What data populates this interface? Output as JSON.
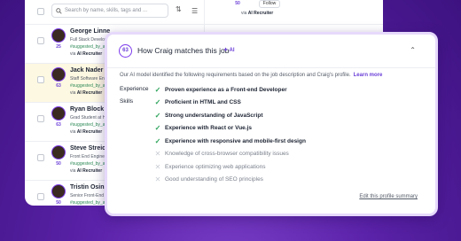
{
  "search": {
    "placeholder": "Search by name, skills, tags and ..."
  },
  "candidates": [
    {
      "name": "George Linne",
      "role": "Full Stack Develop",
      "tag": "#suggested_by_a",
      "via_prefix": "via",
      "via": "AI Recruiter",
      "score": "25",
      "highlight": false
    },
    {
      "name": "Jack Nader",
      "role": "Staff Software Eng",
      "tag": "#suggested_by_a",
      "via_prefix": "via",
      "via": "AI Recruiter",
      "score": "63",
      "highlight": true
    },
    {
      "name": "Ryan Block",
      "role": "Grad Student at H",
      "tag": "#suggested_by_a",
      "via_prefix": "via",
      "via": "AI Recruiter",
      "score": "63",
      "highlight": false
    },
    {
      "name": "Steve Streick",
      "role": "Front End Enginee",
      "tag": "#suggested_by_a",
      "via_prefix": "via",
      "via": "AI Recruiter",
      "score": "50",
      "highlight": false
    },
    {
      "name": "Tristin Osinsk",
      "role": "Senior Front-End",
      "tag": "#suggested_by_a",
      "via_prefix": "via",
      "via": "AI Recruiter",
      "score": "50",
      "highlight": false
    }
  ],
  "right_pane": {
    "score": "50",
    "follow_label": "Follow",
    "via_prefix": "via",
    "via": "AI Recruiter"
  },
  "panel": {
    "score": "63",
    "title": "How Craig matches this job",
    "ai_label": "AI",
    "intro": "Our AI model identified the following requirements based on the job description and Craig's profile.",
    "learn_more": "Learn more",
    "label_experience": "Experience",
    "label_skills": "Skills",
    "requirements": [
      {
        "text": "Proven experience as a Front-end Developer",
        "met": true
      },
      {
        "text": "Proficient in HTML and CSS",
        "met": true
      },
      {
        "text": "Strong understanding of JavaScript",
        "met": true
      },
      {
        "text": "Experience with React or Vue.js",
        "met": true
      },
      {
        "text": "Experience with responsive and mobile-first design",
        "met": true
      },
      {
        "text": "Knowledge of cross-browser compatibility issues",
        "met": false
      },
      {
        "text": "Experience optimizing web applications",
        "met": false
      },
      {
        "text": "Good understanding of SEO principles",
        "met": false
      }
    ],
    "edit_link": "Edit this profile summary"
  },
  "colors": {
    "accent": "#6b3fd8",
    "check": "#2ba35a",
    "background": "#5a22a8"
  }
}
